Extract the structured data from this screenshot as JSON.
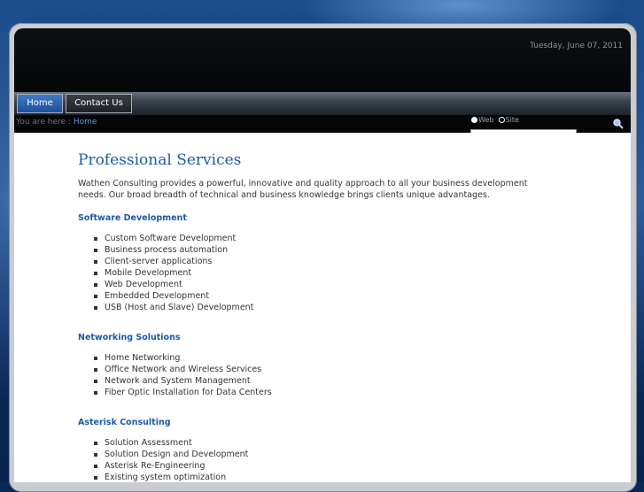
{
  "header": {
    "date": "Tuesday, June 07, 2011"
  },
  "nav": {
    "home": "Home",
    "contact": "Contact Us"
  },
  "breadcrumb": {
    "prefix": "You are here :",
    "current": "Home"
  },
  "search": {
    "option_web": "Web",
    "option_site": "Site",
    "value": "",
    "selected": "Web"
  },
  "main": {
    "title": "Professional Services",
    "intro": "Wathen Consulting provides a powerful, innovative and quality approach to all your business development needs. Our broad breadth of technical and business knowledge brings clients unique advantages.",
    "sections": [
      {
        "heading": "Software Development",
        "items": [
          "Custom Software Development",
          "Business process automation",
          "Client-server applications",
          "Mobile Development",
          "Web Development",
          "Embedded Development",
          "USB (Host and Slave) Development"
        ]
      },
      {
        "heading": "Networking Solutions",
        "items": [
          "Home Networking",
          "Office Network and Wireless Services",
          "Network and System Management",
          "Fiber Optic Installation for Data Centers"
        ]
      },
      {
        "heading": "Asterisk Consulting",
        "items": [
          "Solution Assessment",
          "Solution Design and Development",
          "Asterisk Re-Engineering",
          "Existing system optimization"
        ]
      }
    ]
  }
}
